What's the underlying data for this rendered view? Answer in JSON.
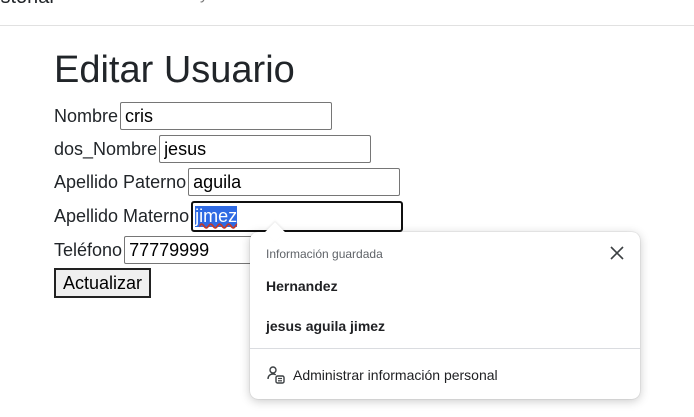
{
  "topbar": {
    "brand": "istorial",
    "nav_fragment": "y"
  },
  "page": {
    "title": "Editar Usuario"
  },
  "form": {
    "fields": [
      {
        "label": "Nombre",
        "value": "cris"
      },
      {
        "label": "dos_Nombre",
        "value": "jesus"
      },
      {
        "label": "Apellido Paterno",
        "value": "aguila"
      },
      {
        "label": "Apellido Materno",
        "value": "jimez"
      },
      {
        "label": "Teléfono",
        "value": "77779999"
      }
    ],
    "submit_label": "Actualizar"
  },
  "autofill": {
    "header": "Información guardada",
    "suggestions": [
      "Hernandez",
      "jesus aguila jimez"
    ],
    "manage_label": "Administrar información personal",
    "close_icon": "close-icon",
    "manage_icon": "person-card-icon"
  }
}
